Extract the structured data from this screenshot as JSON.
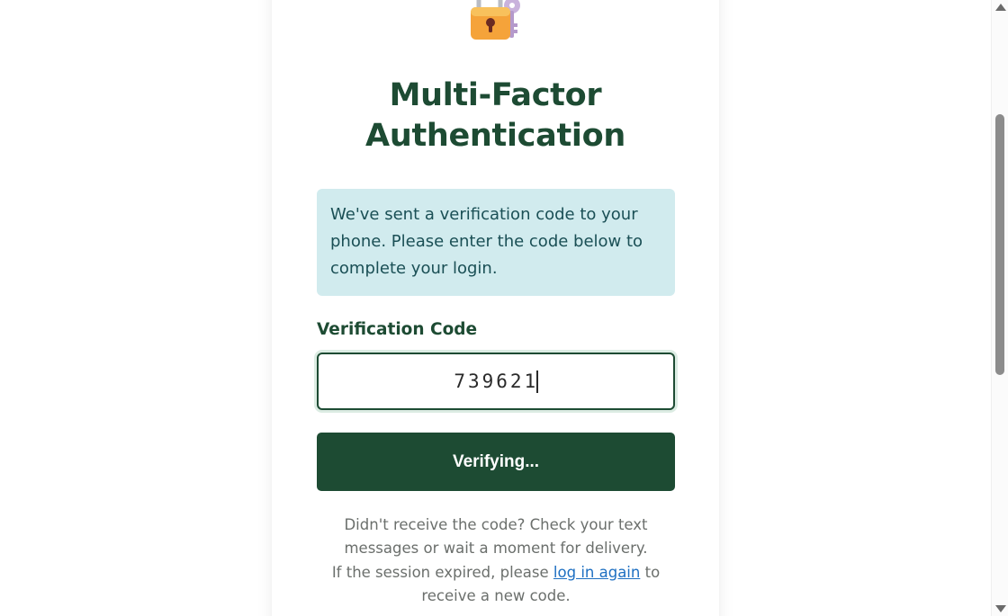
{
  "page": {
    "title_line1": "Multi-Factor",
    "title_line2": "Authentication",
    "icon": "lock-key-icon"
  },
  "info": {
    "message": "We've sent a verification code to your phone. Please enter the code below to complete your login."
  },
  "form": {
    "code_label": "Verification Code",
    "code_value": "739621",
    "submit_label": "Verifying..."
  },
  "help": {
    "line1": "Didn't receive the code? Check your text messages or wait a moment for delivery.",
    "line2_prefix": "If the session expired, please",
    "link_label": "log in again",
    "line2_suffix": "to receive a new code."
  },
  "colors": {
    "accent": "#1d4b33",
    "info_bg": "#d1ebee",
    "link": "#1d6fc2"
  }
}
